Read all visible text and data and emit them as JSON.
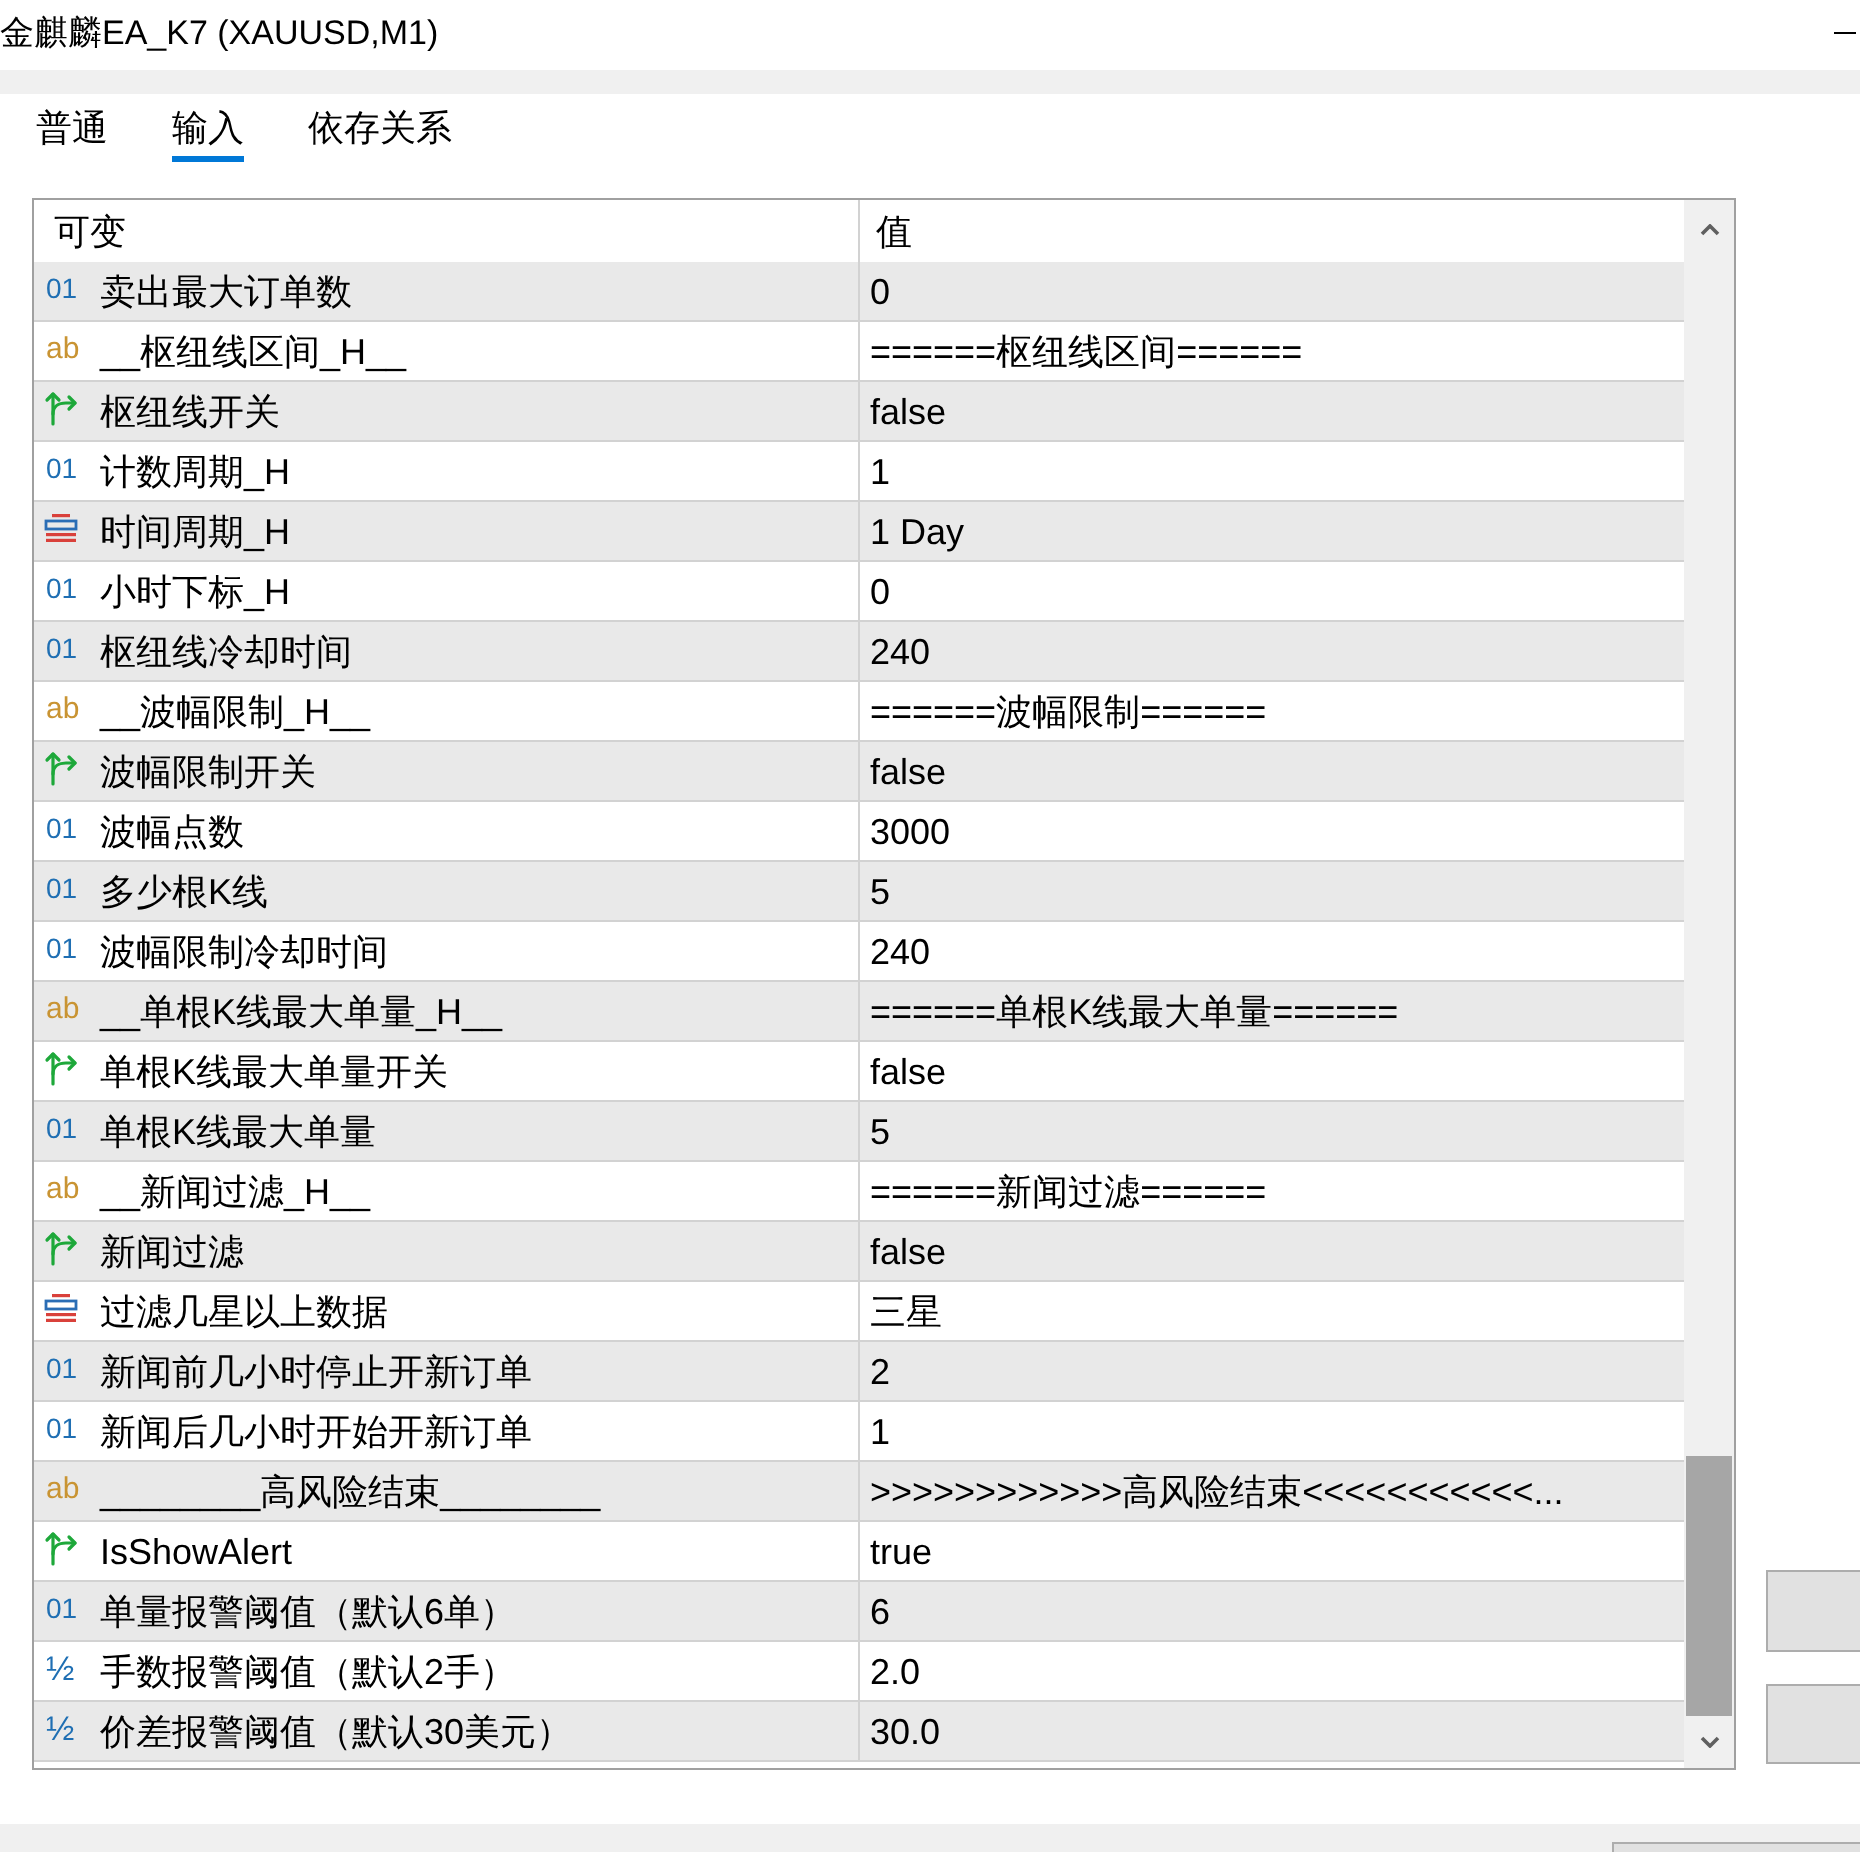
{
  "window": {
    "title": "金麒麟EA_K7 (XAUUSD,M1)"
  },
  "tabs": [
    {
      "label": "普通",
      "selected": false
    },
    {
      "label": "输入",
      "selected": true
    },
    {
      "label": "依存关系",
      "selected": false
    }
  ],
  "table": {
    "columns": [
      "可变",
      "值"
    ],
    "rows": [
      {
        "kind": "int",
        "type_mark": "01",
        "name": "卖出最大订单数",
        "value": "0"
      },
      {
        "kind": "string",
        "type_mark": "ab",
        "name": "__枢纽线区间_H__",
        "value": "======枢纽线区间======"
      },
      {
        "kind": "bool",
        "name": "枢纽线开关",
        "value": "false"
      },
      {
        "kind": "int",
        "type_mark": "01",
        "name": "计数周期_H",
        "value": "1"
      },
      {
        "kind": "enum",
        "name": "时间周期_H",
        "value": "1 Day"
      },
      {
        "kind": "int",
        "type_mark": "01",
        "name": "小时下标_H",
        "value": "0"
      },
      {
        "kind": "int",
        "type_mark": "01",
        "name": "枢纽线冷却时间",
        "value": "240"
      },
      {
        "kind": "string",
        "type_mark": "ab",
        "name": "__波幅限制_H__",
        "value": "======波幅限制======"
      },
      {
        "kind": "bool",
        "name": "波幅限制开关",
        "value": "false"
      },
      {
        "kind": "int",
        "type_mark": "01",
        "name": "波幅点数",
        "value": "3000"
      },
      {
        "kind": "int",
        "type_mark": "01",
        "name": "多少根K线",
        "value": "5"
      },
      {
        "kind": "int",
        "type_mark": "01",
        "name": "波幅限制冷却时间",
        "value": "240"
      },
      {
        "kind": "string",
        "type_mark": "ab",
        "name": "__单根K线最大单量_H__",
        "value": "======单根K线最大单量======"
      },
      {
        "kind": "bool",
        "name": "单根K线最大单量开关",
        "value": "false"
      },
      {
        "kind": "int",
        "type_mark": "01",
        "name": "单根K线最大单量",
        "value": "5"
      },
      {
        "kind": "string",
        "type_mark": "ab",
        "name": "__新闻过滤_H__",
        "value": "======新闻过滤======"
      },
      {
        "kind": "bool",
        "name": "新闻过滤",
        "value": "false"
      },
      {
        "kind": "enum",
        "name": "过滤几星以上数据",
        "value": "三星"
      },
      {
        "kind": "int",
        "type_mark": "01",
        "name": "新闻前几小时停止开新订单",
        "value": "2"
      },
      {
        "kind": "int",
        "type_mark": "01",
        "name": "新闻后几小时开始开新订单",
        "value": "1"
      },
      {
        "kind": "string",
        "type_mark": "ab",
        "name": "________高风险结束________",
        "value": ">>>>>>>>>>>>高风险结束<<<<<<<<<<<..."
      },
      {
        "kind": "bool",
        "name": "IsShowAlert",
        "value": "true"
      },
      {
        "kind": "int",
        "type_mark": "01",
        "name": "单量报警阈值（默认6单）",
        "value": "6"
      },
      {
        "kind": "double",
        "type_mark": "½",
        "name": "手数报警阈值（默认2手）",
        "value": "2.0"
      },
      {
        "kind": "double",
        "type_mark": "½",
        "name": "价差报警阈值（默认30美元）",
        "value": "30.0"
      }
    ]
  }
}
